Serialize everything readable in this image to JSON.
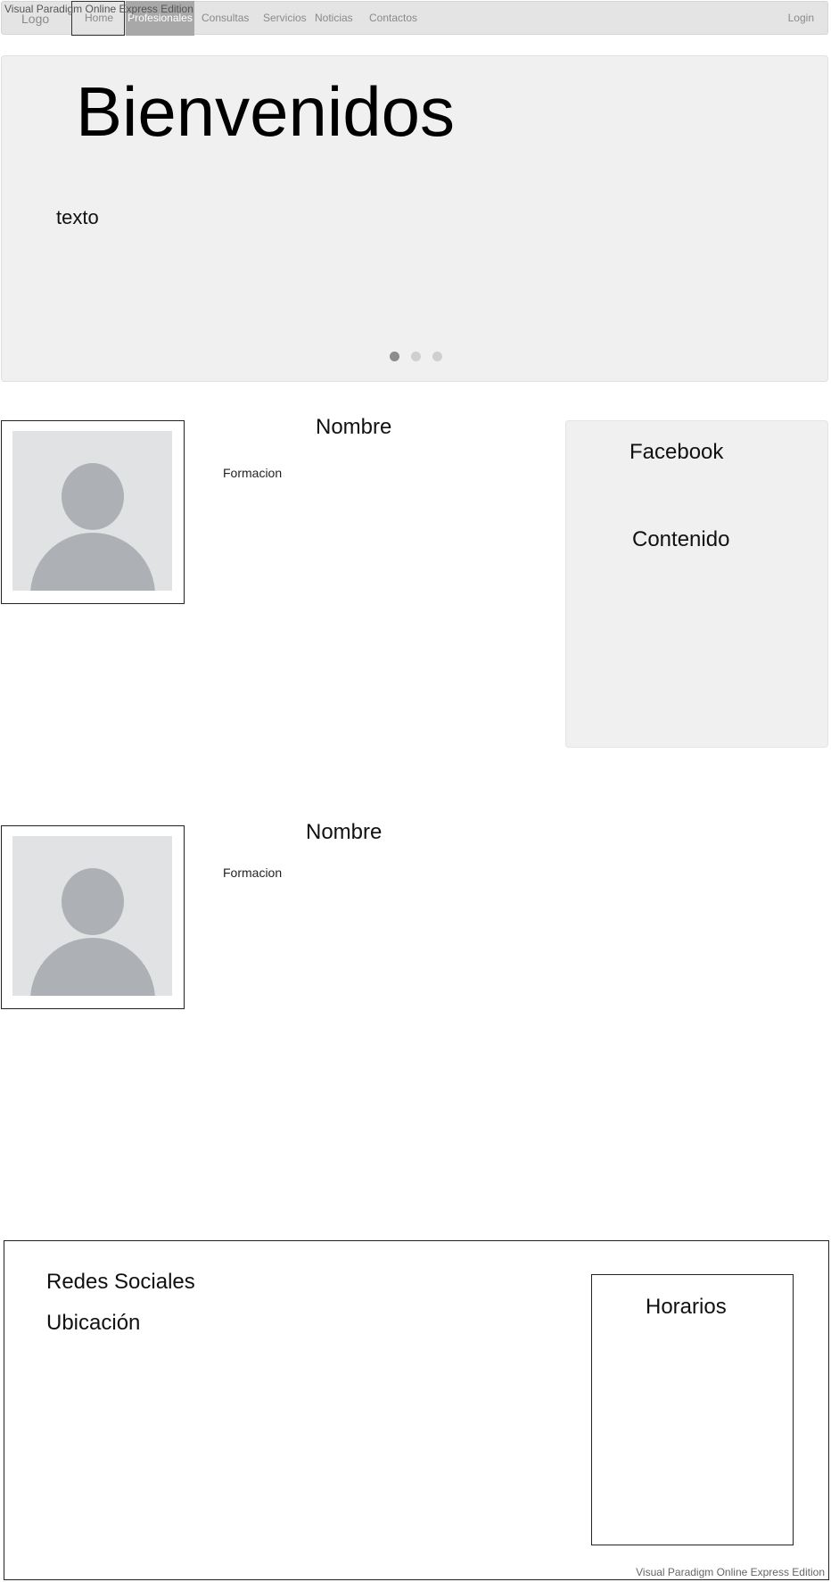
{
  "watermark": "Visual Paradigm Online Express Edition",
  "nav": {
    "logo": "Logo",
    "items": [
      "Home",
      "Profesionales",
      "Consultas",
      "Servicios",
      "Noticias",
      "Contactos"
    ],
    "active": "Profesionales",
    "login": "Login"
  },
  "hero": {
    "title": "Bienvenidos",
    "text": "texto",
    "carousel_dots": 3,
    "active_dot": 1
  },
  "profiles": [
    {
      "name": "Nombre",
      "formation": "Formacion"
    },
    {
      "name": "Nombre",
      "formation": "Formacion"
    }
  ],
  "facebook": {
    "title": "Facebook",
    "content": "Contenido"
  },
  "footer": {
    "social": "Redes Sociales",
    "location": "Ubicación",
    "hours": "Horarios"
  },
  "colors": {
    "nav_bg": "#e4e4e4",
    "nav_active_bg": "#a8a8a8",
    "panel_bg": "#f0f0f0",
    "dot_active": "#8c8c8c",
    "dot_inactive": "#cfcfcf"
  }
}
